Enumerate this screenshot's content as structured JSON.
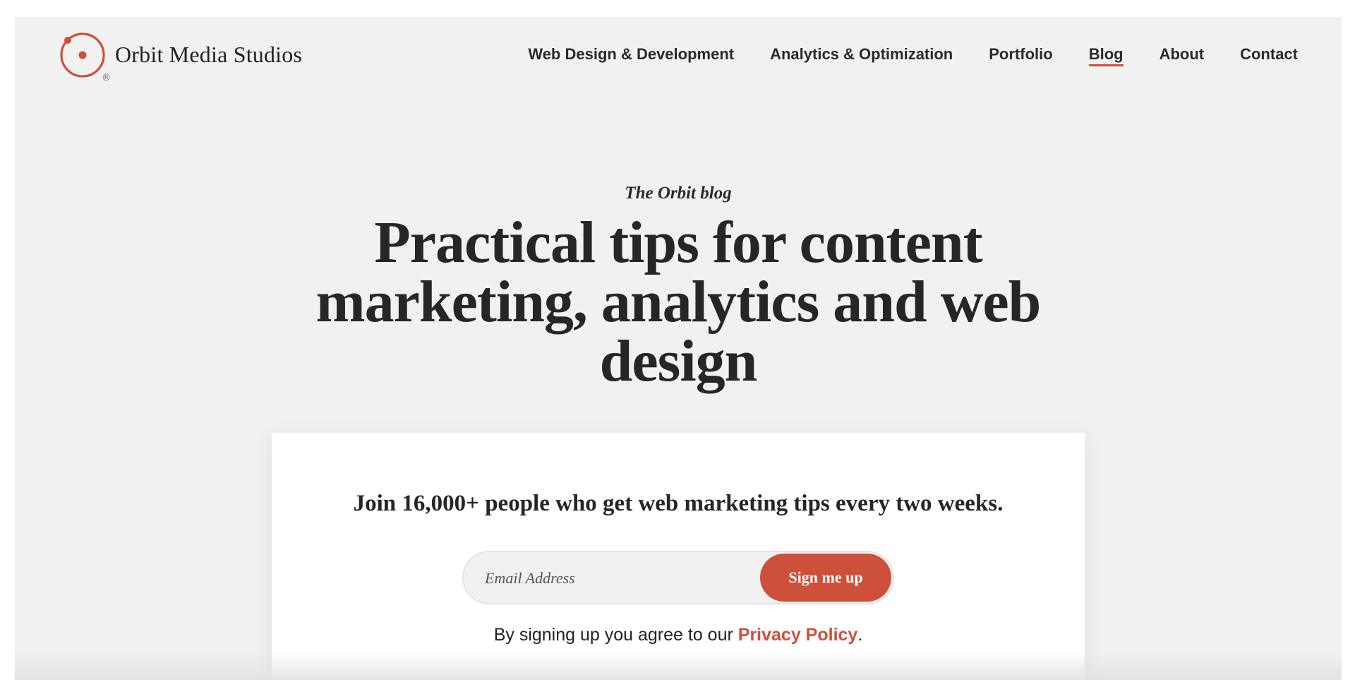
{
  "brand": {
    "name": "Orbit Media Studios",
    "registered_mark": "®",
    "accent_color": "#cd503a"
  },
  "nav": {
    "items": [
      {
        "label": "Web Design & Development",
        "active": false
      },
      {
        "label": "Analytics & Optimization",
        "active": false
      },
      {
        "label": "Portfolio",
        "active": false
      },
      {
        "label": "Blog",
        "active": true
      },
      {
        "label": "About",
        "active": false
      },
      {
        "label": "Contact",
        "active": false
      }
    ]
  },
  "hero": {
    "eyebrow": "The Orbit blog",
    "title": "Practical tips for content marketing, analytics and web design"
  },
  "signup": {
    "heading": "Join 16,000+ people who get web marketing tips every two weeks.",
    "email_placeholder": "Email Address",
    "email_value": "",
    "button_label": "Sign me up",
    "consent_prefix": "By signing up you agree to our ",
    "consent_link": "Privacy Policy",
    "consent_suffix": "."
  },
  "icons": {
    "logo": "orbit-logo-icon"
  }
}
